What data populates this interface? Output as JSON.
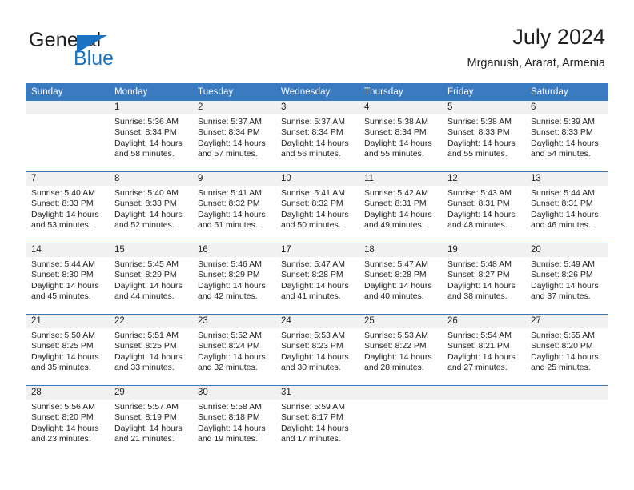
{
  "brand": {
    "name_part1": "General",
    "name_part2": "Blue",
    "triangle_color": "#1a72c4"
  },
  "header": {
    "title": "July 2024",
    "subtitle": "Mrganush, Ararat, Armenia",
    "accent_color": "#3a7ac0",
    "daynum_band_color": "#f1f1f1"
  },
  "weekday_headers": [
    "Sunday",
    "Monday",
    "Tuesday",
    "Wednesday",
    "Thursday",
    "Friday",
    "Saturday"
  ],
  "labels": {
    "sunrise": "Sunrise:",
    "sunset": "Sunset:",
    "daylight": "Daylight:"
  },
  "weeks": [
    {
      "days": [
        {
          "num": "",
          "sunrise": "",
          "sunset": "",
          "daylight_line1": "",
          "daylight_line2": ""
        },
        {
          "num": "1",
          "sunrise": "Sunrise: 5:36 AM",
          "sunset": "Sunset: 8:34 PM",
          "daylight_line1": "Daylight: 14 hours",
          "daylight_line2": "and 58 minutes."
        },
        {
          "num": "2",
          "sunrise": "Sunrise: 5:37 AM",
          "sunset": "Sunset: 8:34 PM",
          "daylight_line1": "Daylight: 14 hours",
          "daylight_line2": "and 57 minutes."
        },
        {
          "num": "3",
          "sunrise": "Sunrise: 5:37 AM",
          "sunset": "Sunset: 8:34 PM",
          "daylight_line1": "Daylight: 14 hours",
          "daylight_line2": "and 56 minutes."
        },
        {
          "num": "4",
          "sunrise": "Sunrise: 5:38 AM",
          "sunset": "Sunset: 8:34 PM",
          "daylight_line1": "Daylight: 14 hours",
          "daylight_line2": "and 55 minutes."
        },
        {
          "num": "5",
          "sunrise": "Sunrise: 5:38 AM",
          "sunset": "Sunset: 8:33 PM",
          "daylight_line1": "Daylight: 14 hours",
          "daylight_line2": "and 55 minutes."
        },
        {
          "num": "6",
          "sunrise": "Sunrise: 5:39 AM",
          "sunset": "Sunset: 8:33 PM",
          "daylight_line1": "Daylight: 14 hours",
          "daylight_line2": "and 54 minutes."
        }
      ]
    },
    {
      "days": [
        {
          "num": "7",
          "sunrise": "Sunrise: 5:40 AM",
          "sunset": "Sunset: 8:33 PM",
          "daylight_line1": "Daylight: 14 hours",
          "daylight_line2": "and 53 minutes."
        },
        {
          "num": "8",
          "sunrise": "Sunrise: 5:40 AM",
          "sunset": "Sunset: 8:33 PM",
          "daylight_line1": "Daylight: 14 hours",
          "daylight_line2": "and 52 minutes."
        },
        {
          "num": "9",
          "sunrise": "Sunrise: 5:41 AM",
          "sunset": "Sunset: 8:32 PM",
          "daylight_line1": "Daylight: 14 hours",
          "daylight_line2": "and 51 minutes."
        },
        {
          "num": "10",
          "sunrise": "Sunrise: 5:41 AM",
          "sunset": "Sunset: 8:32 PM",
          "daylight_line1": "Daylight: 14 hours",
          "daylight_line2": "and 50 minutes."
        },
        {
          "num": "11",
          "sunrise": "Sunrise: 5:42 AM",
          "sunset": "Sunset: 8:31 PM",
          "daylight_line1": "Daylight: 14 hours",
          "daylight_line2": "and 49 minutes."
        },
        {
          "num": "12",
          "sunrise": "Sunrise: 5:43 AM",
          "sunset": "Sunset: 8:31 PM",
          "daylight_line1": "Daylight: 14 hours",
          "daylight_line2": "and 48 minutes."
        },
        {
          "num": "13",
          "sunrise": "Sunrise: 5:44 AM",
          "sunset": "Sunset: 8:31 PM",
          "daylight_line1": "Daylight: 14 hours",
          "daylight_line2": "and 46 minutes."
        }
      ]
    },
    {
      "days": [
        {
          "num": "14",
          "sunrise": "Sunrise: 5:44 AM",
          "sunset": "Sunset: 8:30 PM",
          "daylight_line1": "Daylight: 14 hours",
          "daylight_line2": "and 45 minutes."
        },
        {
          "num": "15",
          "sunrise": "Sunrise: 5:45 AM",
          "sunset": "Sunset: 8:29 PM",
          "daylight_line1": "Daylight: 14 hours",
          "daylight_line2": "and 44 minutes."
        },
        {
          "num": "16",
          "sunrise": "Sunrise: 5:46 AM",
          "sunset": "Sunset: 8:29 PM",
          "daylight_line1": "Daylight: 14 hours",
          "daylight_line2": "and 42 minutes."
        },
        {
          "num": "17",
          "sunrise": "Sunrise: 5:47 AM",
          "sunset": "Sunset: 8:28 PM",
          "daylight_line1": "Daylight: 14 hours",
          "daylight_line2": "and 41 minutes."
        },
        {
          "num": "18",
          "sunrise": "Sunrise: 5:47 AM",
          "sunset": "Sunset: 8:28 PM",
          "daylight_line1": "Daylight: 14 hours",
          "daylight_line2": "and 40 minutes."
        },
        {
          "num": "19",
          "sunrise": "Sunrise: 5:48 AM",
          "sunset": "Sunset: 8:27 PM",
          "daylight_line1": "Daylight: 14 hours",
          "daylight_line2": "and 38 minutes."
        },
        {
          "num": "20",
          "sunrise": "Sunrise: 5:49 AM",
          "sunset": "Sunset: 8:26 PM",
          "daylight_line1": "Daylight: 14 hours",
          "daylight_line2": "and 37 minutes."
        }
      ]
    },
    {
      "days": [
        {
          "num": "21",
          "sunrise": "Sunrise: 5:50 AM",
          "sunset": "Sunset: 8:25 PM",
          "daylight_line1": "Daylight: 14 hours",
          "daylight_line2": "and 35 minutes."
        },
        {
          "num": "22",
          "sunrise": "Sunrise: 5:51 AM",
          "sunset": "Sunset: 8:25 PM",
          "daylight_line1": "Daylight: 14 hours",
          "daylight_line2": "and 33 minutes."
        },
        {
          "num": "23",
          "sunrise": "Sunrise: 5:52 AM",
          "sunset": "Sunset: 8:24 PM",
          "daylight_line1": "Daylight: 14 hours",
          "daylight_line2": "and 32 minutes."
        },
        {
          "num": "24",
          "sunrise": "Sunrise: 5:53 AM",
          "sunset": "Sunset: 8:23 PM",
          "daylight_line1": "Daylight: 14 hours",
          "daylight_line2": "and 30 minutes."
        },
        {
          "num": "25",
          "sunrise": "Sunrise: 5:53 AM",
          "sunset": "Sunset: 8:22 PM",
          "daylight_line1": "Daylight: 14 hours",
          "daylight_line2": "and 28 minutes."
        },
        {
          "num": "26",
          "sunrise": "Sunrise: 5:54 AM",
          "sunset": "Sunset: 8:21 PM",
          "daylight_line1": "Daylight: 14 hours",
          "daylight_line2": "and 27 minutes."
        },
        {
          "num": "27",
          "sunrise": "Sunrise: 5:55 AM",
          "sunset": "Sunset: 8:20 PM",
          "daylight_line1": "Daylight: 14 hours",
          "daylight_line2": "and 25 minutes."
        }
      ]
    },
    {
      "days": [
        {
          "num": "28",
          "sunrise": "Sunrise: 5:56 AM",
          "sunset": "Sunset: 8:20 PM",
          "daylight_line1": "Daylight: 14 hours",
          "daylight_line2": "and 23 minutes."
        },
        {
          "num": "29",
          "sunrise": "Sunrise: 5:57 AM",
          "sunset": "Sunset: 8:19 PM",
          "daylight_line1": "Daylight: 14 hours",
          "daylight_line2": "and 21 minutes."
        },
        {
          "num": "30",
          "sunrise": "Sunrise: 5:58 AM",
          "sunset": "Sunset: 8:18 PM",
          "daylight_line1": "Daylight: 14 hours",
          "daylight_line2": "and 19 minutes."
        },
        {
          "num": "31",
          "sunrise": "Sunrise: 5:59 AM",
          "sunset": "Sunset: 8:17 PM",
          "daylight_line1": "Daylight: 14 hours",
          "daylight_line2": "and 17 minutes."
        },
        {
          "num": "",
          "sunrise": "",
          "sunset": "",
          "daylight_line1": "",
          "daylight_line2": ""
        },
        {
          "num": "",
          "sunrise": "",
          "sunset": "",
          "daylight_line1": "",
          "daylight_line2": ""
        },
        {
          "num": "",
          "sunrise": "",
          "sunset": "",
          "daylight_line1": "",
          "daylight_line2": ""
        }
      ]
    }
  ]
}
